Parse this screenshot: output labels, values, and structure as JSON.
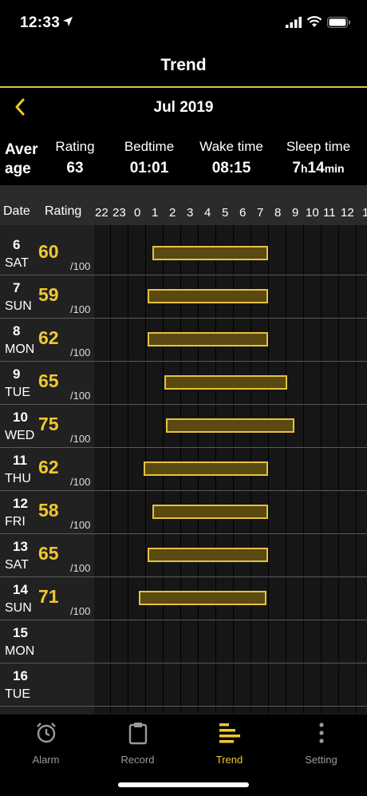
{
  "status_bar": {
    "time": "12:33"
  },
  "nav": {
    "title": "Trend"
  },
  "month": {
    "label": "Jul 2019"
  },
  "average": {
    "title_line1": "Aver",
    "title_line2": "age",
    "rating_label": "Rating",
    "rating_value": "63",
    "bedtime_label": "Bedtime",
    "bedtime_value": "01:01",
    "waketime_label": "Wake time",
    "waketime_value": "08:15",
    "sleeptime_label": "Sleep time",
    "sleeptime_hours": "7",
    "sleeptime_h_unit": "h",
    "sleeptime_minutes": "14",
    "sleeptime_min_unit": "min"
  },
  "table": {
    "date_header": "Date",
    "rating_header": "Rating",
    "hours": [
      "22",
      "23",
      "0",
      "1",
      "2",
      "3",
      "4",
      "5",
      "6",
      "7",
      "8",
      "9",
      "10",
      "11",
      "12",
      "1"
    ],
    "rating_suffix": "/100",
    "rows": [
      {
        "day": "6",
        "dow": "SAT",
        "rating": "60",
        "bed": 0.4,
        "wake": 7.0
      },
      {
        "day": "7",
        "dow": "SUN",
        "rating": "59",
        "bed": 0.15,
        "wake": 7.0
      },
      {
        "day": "8",
        "dow": "MON",
        "rating": "62",
        "bed": 0.15,
        "wake": 7.0
      },
      {
        "day": "9",
        "dow": "TUE",
        "rating": "65",
        "bed": 1.1,
        "wake": 8.1
      },
      {
        "day": "10",
        "dow": "WED",
        "rating": "75",
        "bed": 1.2,
        "wake": 8.5
      },
      {
        "day": "11",
        "dow": "THU",
        "rating": "62",
        "bed": -0.1,
        "wake": 7.0
      },
      {
        "day": "12",
        "dow": "FRI",
        "rating": "58",
        "bed": 0.4,
        "wake": 7.0
      },
      {
        "day": "13",
        "dow": "SAT",
        "rating": "65",
        "bed": 0.15,
        "wake": 7.0
      },
      {
        "day": "14",
        "dow": "SUN",
        "rating": "71",
        "bed": -0.35,
        "wake": 6.9
      },
      {
        "day": "15",
        "dow": "MON",
        "rating": ""
      },
      {
        "day": "16",
        "dow": "TUE",
        "rating": ""
      }
    ]
  },
  "tabs": [
    {
      "label": "Alarm",
      "icon": "alarm-clock-icon",
      "active": false
    },
    {
      "label": "Record",
      "icon": "clipboard-icon",
      "active": false
    },
    {
      "label": "Trend",
      "icon": "trend-bars-icon",
      "active": true
    },
    {
      "label": "Setting",
      "icon": "more-dots-icon",
      "active": false
    }
  ],
  "colors": {
    "accent": "#f0c82e",
    "bar_fill": "#5a4a12",
    "bar_border": "#e6c13d",
    "background": "#000000"
  }
}
